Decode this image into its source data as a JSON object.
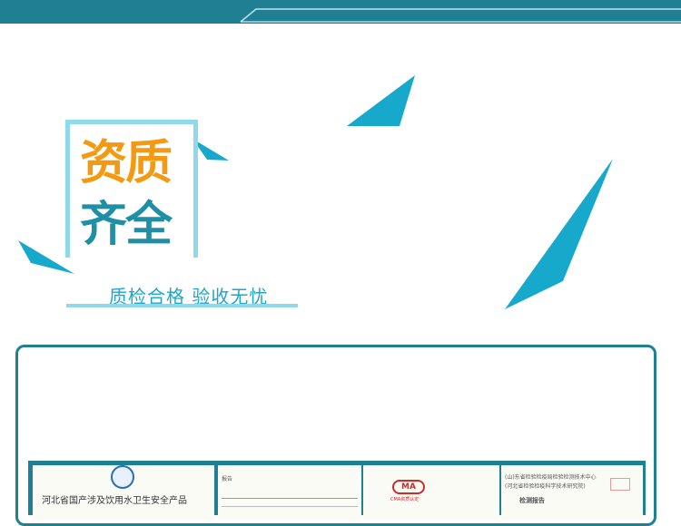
{
  "title": {
    "line1": "资质",
    "line2": "齐全"
  },
  "subtitle": "质检合格  验收无忧",
  "certificates": [
    {
      "heading": "河北省国产涉及饮用水卫生安全产品",
      "seal_icon": "emblem-seal-icon"
    },
    {
      "heading": "",
      "note": "报告"
    },
    {
      "logo_text": "MA",
      "logo_caption": "CMA资质认定"
    },
    {
      "org_line1": "(山)东省检验检疫局检验检测技术中心",
      "org_line2": "(河北省检验检疫科学技术研究院)",
      "report_label": "检测报告"
    }
  ],
  "colors": {
    "top_bar": "#1f7f93",
    "accent_orange": "#f39a12",
    "accent_teal": "#1f8fa6",
    "triangle_blue": "#16a9cc",
    "frame_light": "#8fd9ea"
  }
}
